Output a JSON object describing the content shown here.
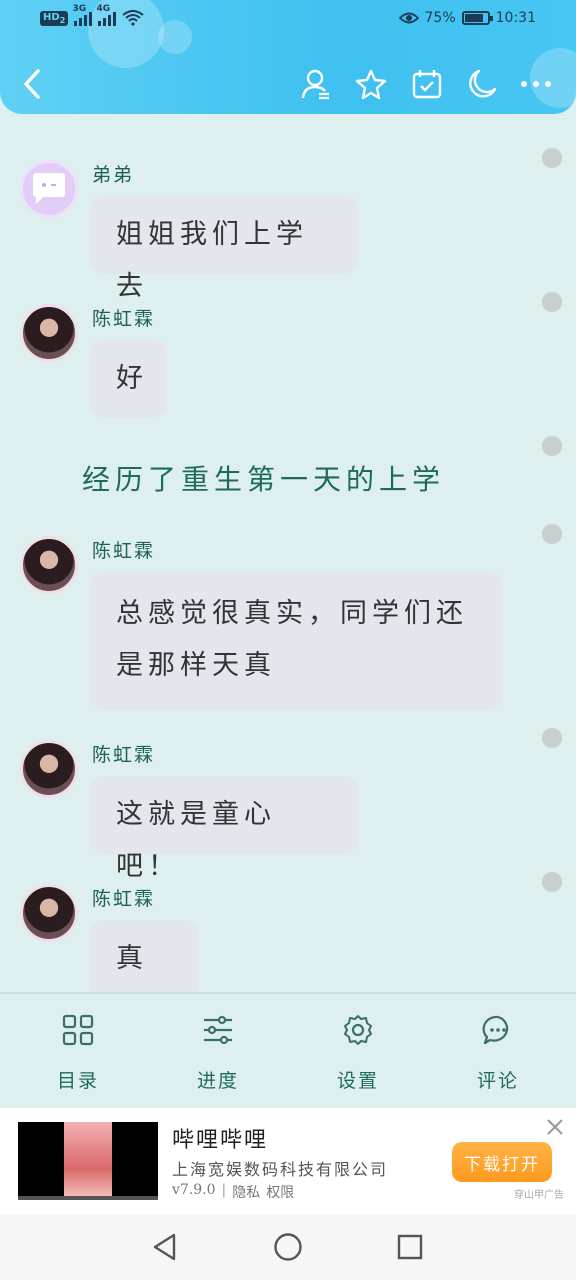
{
  "status_bar": {
    "hd": "HD",
    "hd_sub": "2",
    "net1": "3G",
    "net2": "4G",
    "battery_text": "75%",
    "battery_level": 0.75,
    "time": "10:31"
  },
  "nav": {
    "icons": [
      "back-icon",
      "author-icon",
      "star-icon",
      "calendar-check-icon",
      "moon-icon",
      "more-icon"
    ]
  },
  "messages": [
    {
      "speaker": "弟弟",
      "text": "姐姐我们上学去"
    },
    {
      "speaker": "陈虹霖",
      "text": "好"
    },
    {
      "narration": "经历了重生第一天的上学"
    },
    {
      "speaker": "陈虹霖",
      "line1": "总感觉很真实，同学们还",
      "line2": "是那样天真"
    },
    {
      "speaker": "陈虹霖",
      "text": "这就是童心吧！"
    },
    {
      "speaker": "陈虹霖",
      "text": "真好"
    }
  ],
  "menu": {
    "items": [
      {
        "label": "目录",
        "icon": "grid-icon"
      },
      {
        "label": "进度",
        "icon": "sliders-icon"
      },
      {
        "label": "设置",
        "icon": "gear-icon"
      },
      {
        "label": "评论",
        "icon": "comment-icon"
      }
    ]
  },
  "ad": {
    "title": "哔哩哔哩",
    "company": "上海宽娱数码科技有限公司",
    "version": "v7.9.0",
    "separator": "|",
    "privacy": "隐私",
    "permissions": "权限",
    "button": "下载打开",
    "source": "穿山甲广告"
  },
  "colors": {
    "header": "#3ec0f0",
    "background": "#ddf0ef",
    "bubble": "#e3e6ec",
    "accent_text": "#1e6b5e",
    "ad_button": "#ff9a1f"
  }
}
